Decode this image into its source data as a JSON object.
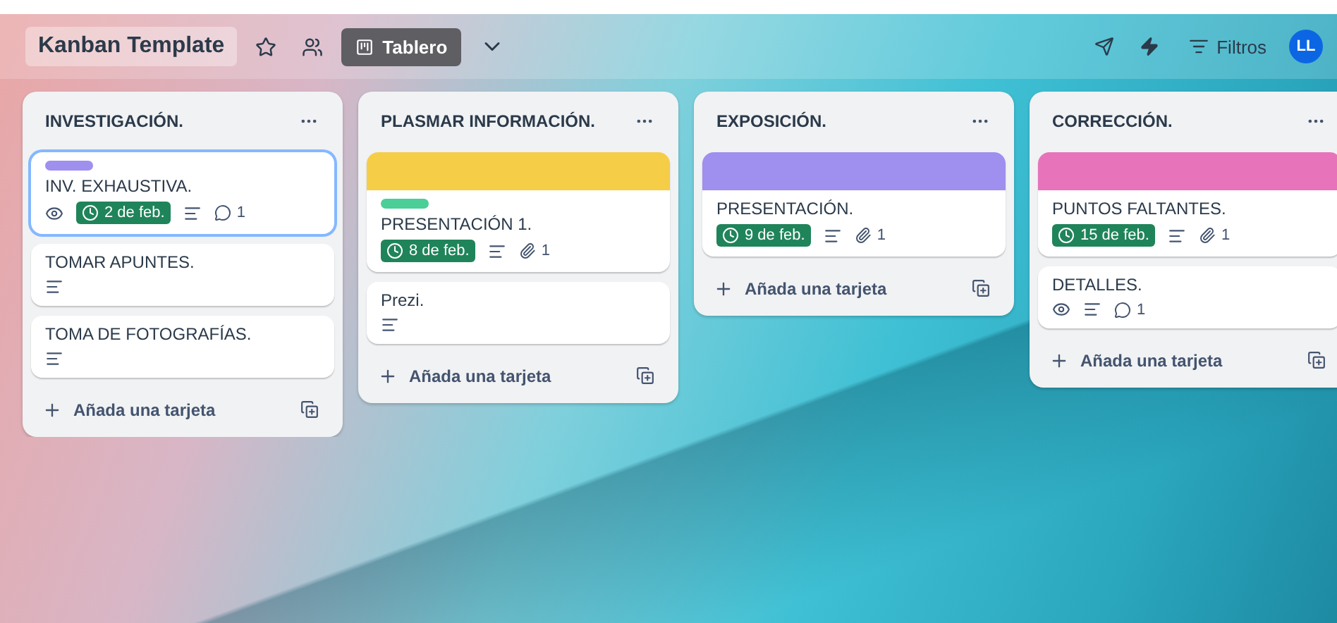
{
  "header": {
    "board_title": "Kanban Template",
    "view_label": "Tablero",
    "filter_label": "Filtros",
    "avatar_initials": "LL"
  },
  "lists": [
    {
      "title": "INVESTIGACIÓN.",
      "add_label": "Añada una tarjeta",
      "cards": [
        {
          "title": "INV. EXHAUSTIVA.",
          "selected": true,
          "label": {
            "color": "#9f8fef"
          },
          "badges": [
            {
              "kind": "watch"
            },
            {
              "kind": "due",
              "text": "2 de feb."
            },
            {
              "kind": "description"
            },
            {
              "kind": "comments",
              "text": "1"
            }
          ]
        },
        {
          "title": "TOMAR APUNTES.",
          "selected": false,
          "badges": [
            {
              "kind": "description"
            }
          ]
        },
        {
          "title": "TOMA DE FOTOGRAFÍAS.",
          "selected": false,
          "badges": [
            {
              "kind": "description"
            }
          ]
        }
      ]
    },
    {
      "title": "PLASMAR INFORMACIÓN.",
      "add_label": "Añada una tarjeta",
      "cards": [
        {
          "title": "PRESENTACIÓN 1.",
          "selected": false,
          "cover": {
            "color": "#f5cd47"
          },
          "label": {
            "color": "#4bce97"
          },
          "badges": [
            {
              "kind": "due",
              "text": "8 de feb."
            },
            {
              "kind": "description"
            },
            {
              "kind": "attachments",
              "text": "1"
            }
          ]
        },
        {
          "title": "Prezi.",
          "selected": false,
          "badges": [
            {
              "kind": "description"
            }
          ]
        }
      ]
    },
    {
      "title": "EXPOSICIÓN.",
      "add_label": "Añada una tarjeta",
      "cards": [
        {
          "title": "PRESENTACIÓN.",
          "selected": false,
          "cover": {
            "color": "#9f8fef"
          },
          "badges": [
            {
              "kind": "due",
              "text": "9 de feb."
            },
            {
              "kind": "description"
            },
            {
              "kind": "attachments",
              "text": "1"
            }
          ]
        }
      ]
    },
    {
      "title": "CORRECCIÓN.",
      "add_label": "Añada una tarjeta",
      "cards": [
        {
          "title": "PUNTOS FALTANTES.",
          "selected": false,
          "cover": {
            "color": "#e774bb"
          },
          "badges": [
            {
              "kind": "due",
              "text": "15 de feb."
            },
            {
              "kind": "description"
            },
            {
              "kind": "attachments",
              "text": "1"
            }
          ]
        },
        {
          "title": "DETALLES.",
          "selected": false,
          "badges": [
            {
              "kind": "watch"
            },
            {
              "kind": "description"
            },
            {
              "kind": "comments",
              "text": "1"
            }
          ]
        }
      ]
    }
  ]
}
